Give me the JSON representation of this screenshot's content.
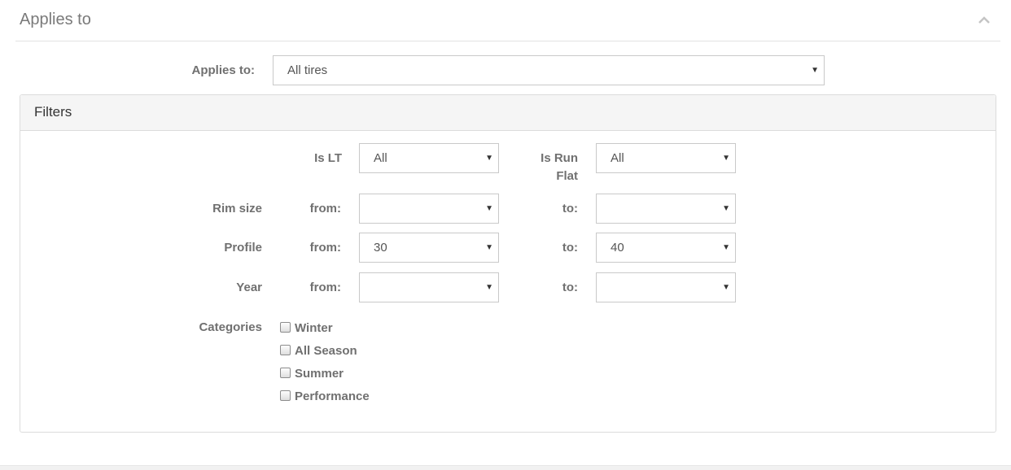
{
  "section": {
    "title": "Applies to"
  },
  "applies_to": {
    "label": "Applies to:",
    "value": "All tires"
  },
  "filters": {
    "title": "Filters",
    "is_lt": {
      "label": "Is LT",
      "value": "All"
    },
    "is_run_flat": {
      "label_line1": "Is Run",
      "label_line2": "Flat",
      "value": "All"
    },
    "rim_size": {
      "label": "Rim size",
      "from_label": "from:",
      "from_value": "",
      "to_label": "to:",
      "to_value": ""
    },
    "profile": {
      "label": "Profile",
      "from_label": "from:",
      "from_value": "30",
      "to_label": "to:",
      "to_value": "40"
    },
    "year": {
      "label": "Year",
      "from_label": "from:",
      "from_value": "",
      "to_label": "to:",
      "to_value": ""
    },
    "categories": {
      "label": "Categories",
      "items": [
        {
          "label": "Winter",
          "checked": false
        },
        {
          "label": "All Season",
          "checked": false
        },
        {
          "label": "Summer",
          "checked": false
        },
        {
          "label": "Performance",
          "checked": false
        }
      ]
    }
  },
  "icons": {
    "collapse": "chevron-up-icon",
    "dropdown": "caret-down-icon"
  },
  "colors": {
    "label": "#707070",
    "border": "#c9c9c9",
    "panel_heading_bg": "#f5f5f5"
  }
}
